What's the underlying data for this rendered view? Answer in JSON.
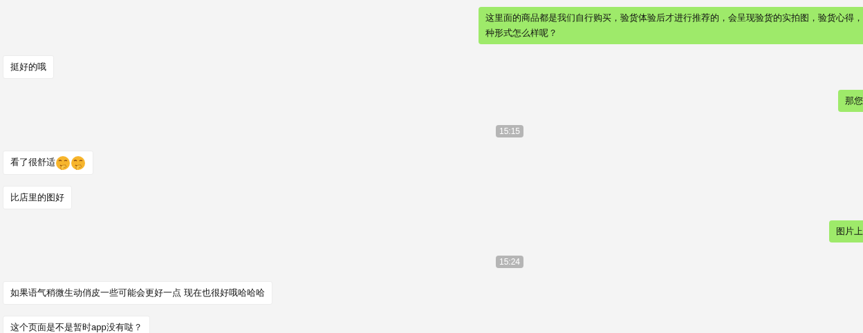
{
  "messages": [
    {
      "kind": "sent",
      "parts": [
        {
          "kind": "text",
          "text": "这里面的商品都是我们自行购买，验货体验后才进行推荐的，会呈现验货的实拍图，验货心得，"
        },
        {
          "kind": "break"
        },
        {
          "kind": "text",
          "text": "种形式怎么样呢？"
        }
      ]
    },
    {
      "kind": "received",
      "parts": [
        {
          "kind": "text",
          "text": "挺好的哦"
        }
      ]
    },
    {
      "kind": "sent",
      "parts": [
        {
          "kind": "text",
          "text": "那您"
        }
      ]
    },
    {
      "kind": "time",
      "text": "15:15"
    },
    {
      "kind": "received",
      "parts": [
        {
          "kind": "text",
          "text": "看了很舒适"
        },
        {
          "kind": "emoji"
        },
        {
          "kind": "emoji"
        }
      ]
    },
    {
      "kind": "received",
      "parts": [
        {
          "kind": "text",
          "text": "比店里的图好"
        }
      ]
    },
    {
      "kind": "sent",
      "parts": [
        {
          "kind": "text",
          "text": "图片上"
        }
      ]
    },
    {
      "kind": "time",
      "text": "15:24"
    },
    {
      "kind": "received",
      "parts": [
        {
          "kind": "text",
          "text": "如果语气稍微生动俏皮一些可能会更好一点 现在也很好哦哈哈哈"
        }
      ]
    },
    {
      "kind": "received",
      "parts": [
        {
          "kind": "text",
          "text": "这个页面是不是暂时app没有哒？"
        }
      ]
    }
  ]
}
